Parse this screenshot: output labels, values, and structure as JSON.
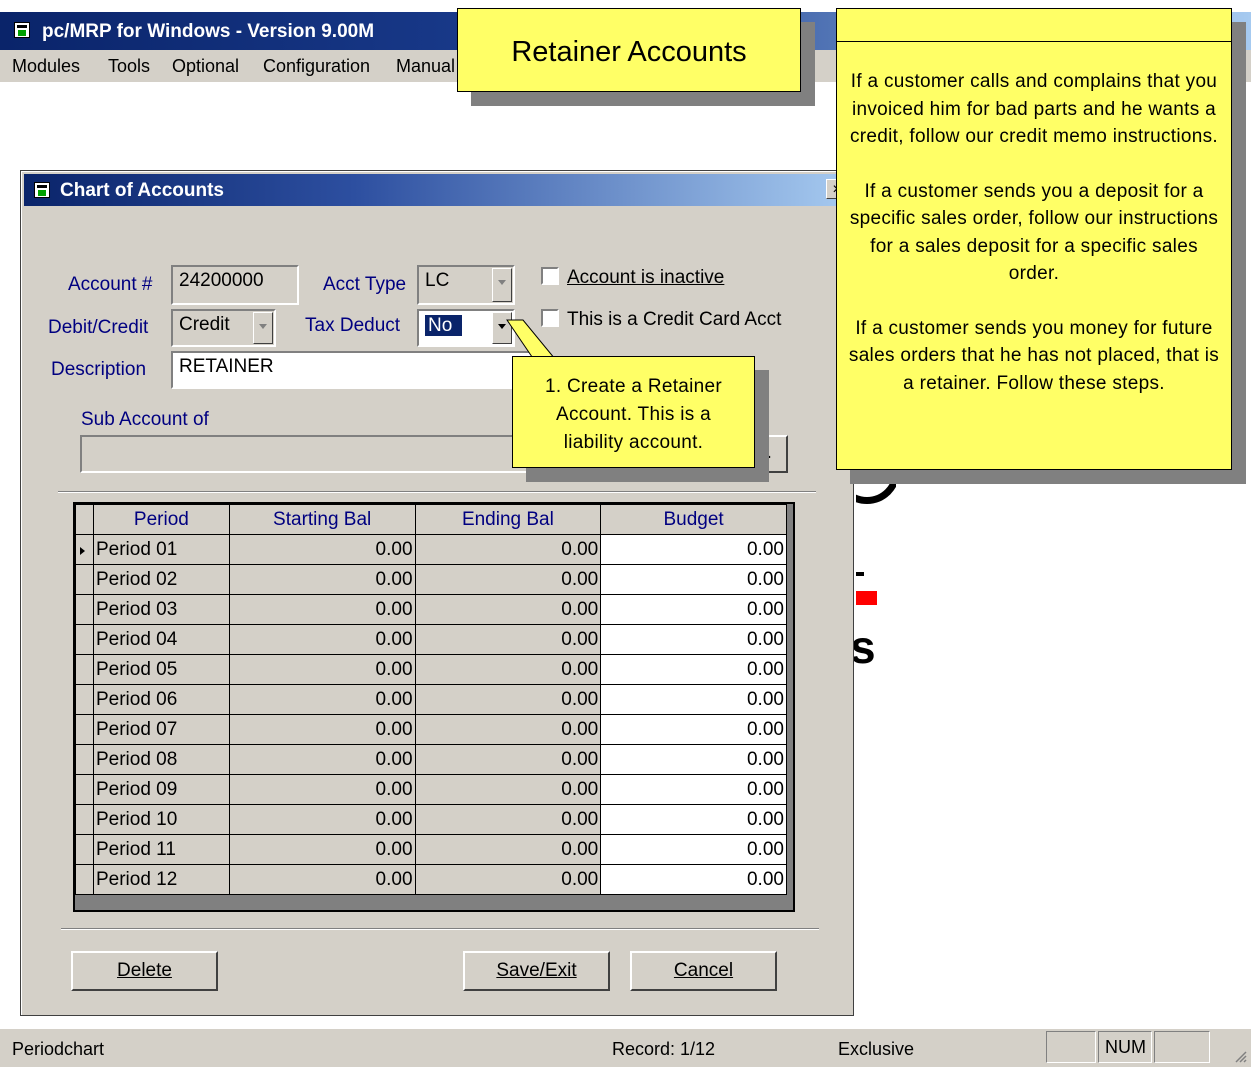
{
  "app": {
    "title": "pc/MRP for Windows - Version 9.00M",
    "menu": [
      "Modules",
      "Tools",
      "Optional",
      "Configuration",
      "Manual"
    ]
  },
  "dialog": {
    "title": "Chart of Accounts",
    "close": "×",
    "account_label": "Account #",
    "account_value": "24200000",
    "acct_type_label": "Acct Type",
    "acct_type_value": "LC",
    "debit_credit_label": "Debit/Credit",
    "debit_credit_value": "Credit",
    "tax_deduct_label": "Tax Deduct",
    "tax_deduct_value": "No",
    "description_label": "Description",
    "description_value": "RETAINER",
    "sub_account_label": "Sub Account of",
    "sub_account_value": "",
    "inactive_label": "Account is inactive",
    "credit_card_label": "This is a Credit Card Acct",
    "browse_label": "..."
  },
  "grid": {
    "headers": [
      "Period",
      "Starting Bal",
      "Ending Bal",
      "Budget"
    ],
    "rows": [
      [
        "Period 01",
        "0.00",
        "0.00",
        "0.00"
      ],
      [
        "Period 02",
        "0.00",
        "0.00",
        "0.00"
      ],
      [
        "Period 03",
        "0.00",
        "0.00",
        "0.00"
      ],
      [
        "Period 04",
        "0.00",
        "0.00",
        "0.00"
      ],
      [
        "Period 05",
        "0.00",
        "0.00",
        "0.00"
      ],
      [
        "Period 06",
        "0.00",
        "0.00",
        "0.00"
      ],
      [
        "Period 07",
        "0.00",
        "0.00",
        "0.00"
      ],
      [
        "Period 08",
        "0.00",
        "0.00",
        "0.00"
      ],
      [
        "Period 09",
        "0.00",
        "0.00",
        "0.00"
      ],
      [
        "Period 10",
        "0.00",
        "0.00",
        "0.00"
      ],
      [
        "Period 11",
        "0.00",
        "0.00",
        "0.00"
      ],
      [
        "Period 12",
        "0.00",
        "0.00",
        "0.00"
      ]
    ]
  },
  "buttons": {
    "delete": "Delete",
    "save_exit": "Save/Exit",
    "cancel": "Cancel"
  },
  "callouts": {
    "title": "Retainer Accounts",
    "step1": "1. Create a Retainer Account. This is a liability account.",
    "info_p1": "If a customer calls and complains that you invoiced him for bad parts and he wants a credit, follow our credit memo instructions.",
    "info_p2": "If a customer sends you a deposit for a specific sales order, follow our instructions for a sales deposit for a specific sales order.",
    "info_p3": "If a customer sends you money for future sales orders that he has not placed, that is a retainer.  Follow these steps."
  },
  "status": {
    "form": "Periodchart",
    "record": "Record: 1/12",
    "mode": "Exclusive",
    "num": "NUM"
  },
  "colors": {
    "callout_bg": "#ffff66",
    "label_blue": "#000080",
    "title_bar": "#0a246a"
  }
}
